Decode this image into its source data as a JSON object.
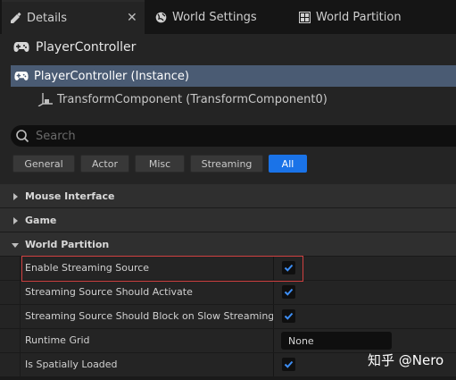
{
  "tabs": [
    {
      "label": "Details",
      "icon": "details-icon",
      "active": true,
      "closable": true
    },
    {
      "label": "World Settings",
      "icon": "globe-icon"
    },
    {
      "label": "World Partition",
      "icon": "grid-icon"
    }
  ],
  "header": {
    "title": "PlayerController",
    "icon": "gamepad-icon"
  },
  "components": {
    "selected": "PlayerController (Instance)",
    "child": "TransformComponent (TransformComponent0)"
  },
  "search": {
    "placeholder": "Search"
  },
  "filters": [
    "General",
    "Actor",
    "Misc",
    "Streaming",
    "All"
  ],
  "active_filter": "All",
  "categories": {
    "mouse_interface": "Mouse Interface",
    "game": "Game",
    "world_partition": "World Partition"
  },
  "properties": [
    {
      "label": "Enable Streaming Source",
      "type": "checkbox",
      "checked": true
    },
    {
      "label": "Streaming Source Should Activate",
      "type": "checkbox",
      "checked": true
    },
    {
      "label": "Streaming Source Should Block on Slow Streaming",
      "type": "checkbox",
      "checked": true
    },
    {
      "label": "Runtime Grid",
      "type": "text",
      "value": "None"
    },
    {
      "label": "Is Spatially Loaded",
      "type": "checkbox",
      "checked": true
    }
  ],
  "watermark": "知乎 @Nero",
  "colors": {
    "accent": "#1a73e8",
    "selection": "#4a5b73",
    "highlight_border": "#d04040"
  }
}
